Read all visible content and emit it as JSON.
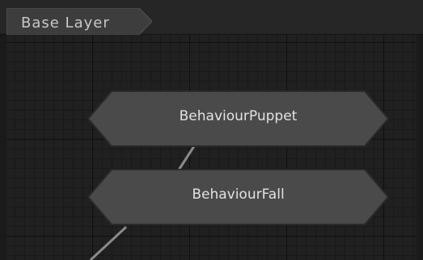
{
  "breadcrumb": {
    "layer_label": "Base Layer"
  },
  "nodes": [
    {
      "label": "BehaviourPuppet"
    },
    {
      "label": "BehaviourFall"
    }
  ],
  "colors": {
    "node_fill": "#4a4a4a",
    "node_border": "#2a2a2a",
    "grid_background": "#202020",
    "toolbar_background": "#262626"
  }
}
